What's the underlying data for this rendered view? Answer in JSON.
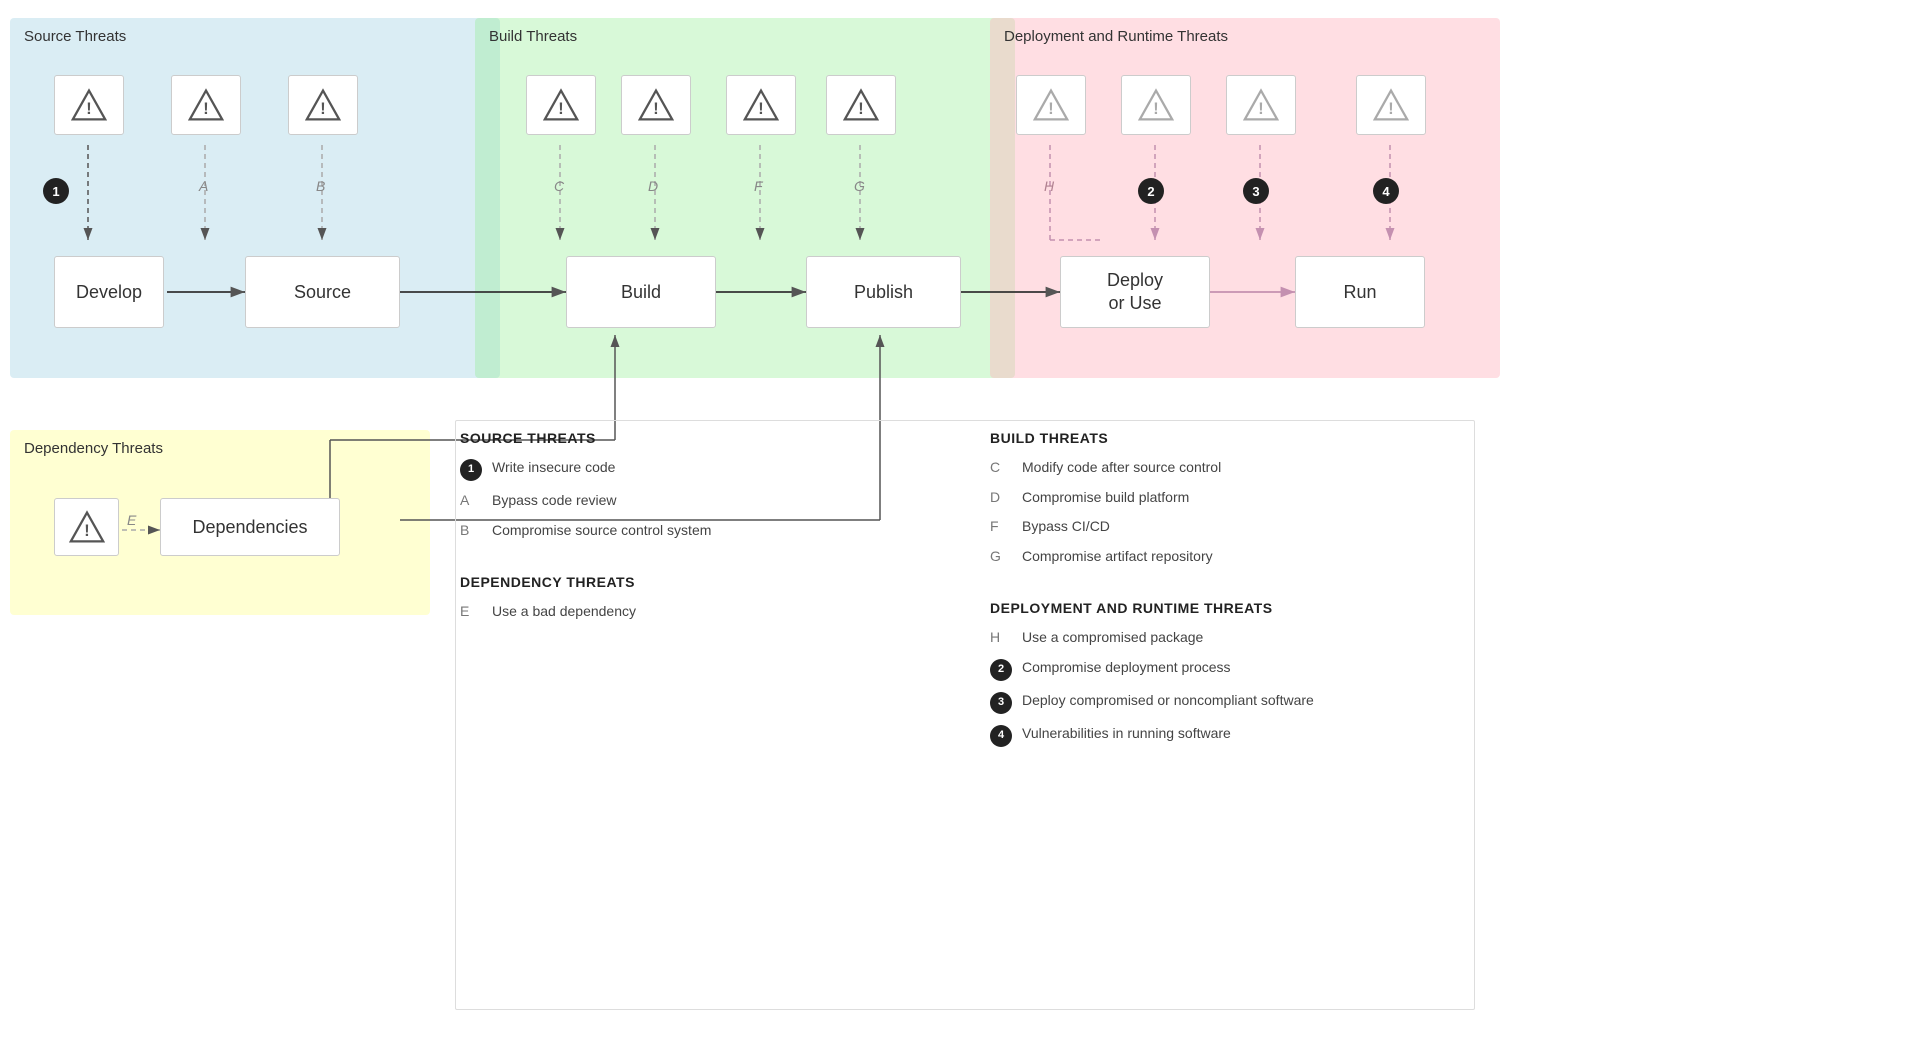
{
  "zones": {
    "source": {
      "label": "Source Threats",
      "color_bg": "rgba(173,216,230,0.45)"
    },
    "build": {
      "label": "Build Threats",
      "color_bg": "rgba(144,238,144,0.35)"
    },
    "runtime": {
      "label": "Deployment and Runtime Threats",
      "color_bg": "rgba(255,182,193,0.45)"
    },
    "dependency": {
      "label": "Dependency Threats",
      "color_bg": "rgba(255,255,180,0.6)"
    }
  },
  "process_nodes": {
    "develop": "Develop",
    "source": "Source",
    "build": "Build",
    "publish": "Publish",
    "deploy": "Deploy\nor Use",
    "run": "Run",
    "dependencies": "Dependencies"
  },
  "legend": {
    "source_title": "SOURCE THREATS",
    "source_items": [
      {
        "key": "1",
        "type": "badge",
        "text": "Write insecure code"
      },
      {
        "key": "A",
        "type": "letter",
        "text": "Bypass code review"
      },
      {
        "key": "B",
        "type": "letter",
        "text": "Compromise source control system"
      }
    ],
    "dependency_title": "DEPENDENCY THREATS",
    "dependency_items": [
      {
        "key": "E",
        "type": "letter",
        "text": "Use a bad dependency"
      }
    ],
    "build_title": "BUILD THREATS",
    "build_items": [
      {
        "key": "C",
        "type": "letter",
        "text": "Modify code after source control"
      },
      {
        "key": "D",
        "type": "letter",
        "text": "Compromise build platform"
      },
      {
        "key": "F",
        "type": "letter",
        "text": "Bypass CI/CD"
      },
      {
        "key": "G",
        "type": "letter",
        "text": "Compromise artifact repository"
      }
    ],
    "runtime_title": "DEPLOYMENT AND RUNTIME THREATS",
    "runtime_items": [
      {
        "key": "H",
        "type": "letter",
        "text": "Use a compromised package"
      },
      {
        "key": "2",
        "type": "badge",
        "text": "Compromise deployment process"
      },
      {
        "key": "3",
        "type": "badge",
        "text": "Deploy compromised or noncompliant software"
      },
      {
        "key": "4",
        "type": "badge",
        "text": "Vulnerabilities in running software"
      }
    ]
  }
}
